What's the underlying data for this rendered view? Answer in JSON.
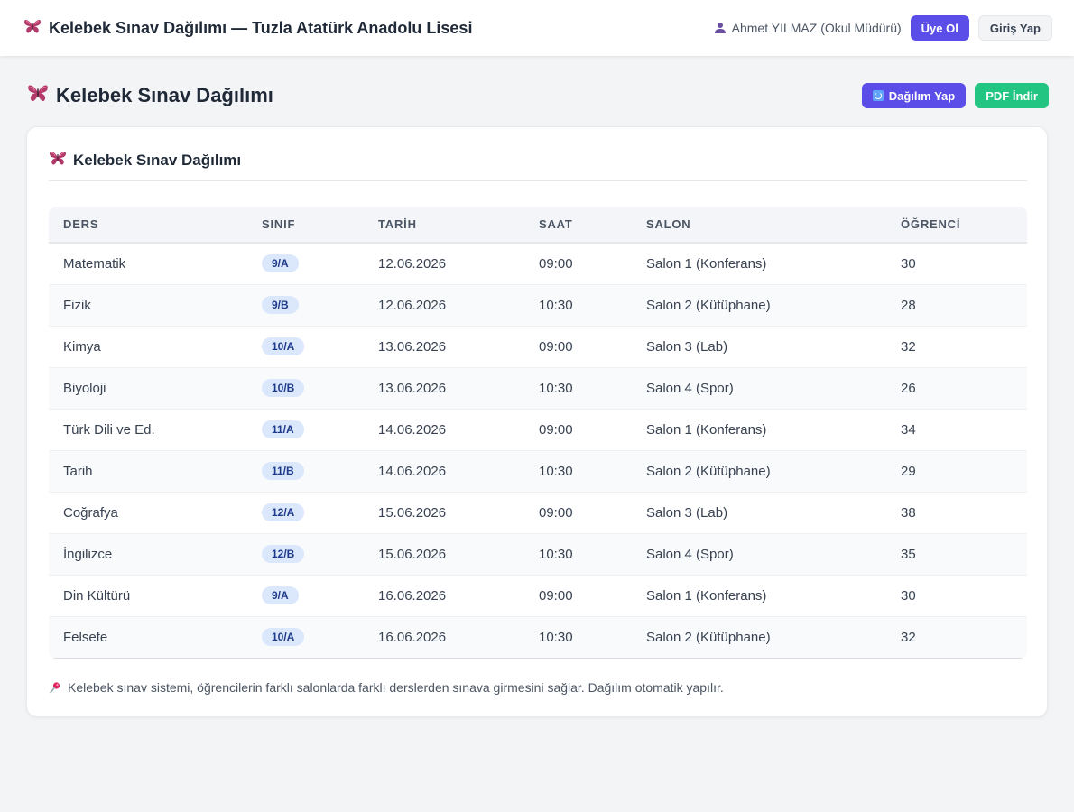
{
  "header": {
    "title": "Kelebek Sınav Dağılımı — Tuzla Atatürk Anadolu Lisesi",
    "user_name": "Ahmet YILMAZ (Okul Müdürü)",
    "signup_label": "Üye Ol",
    "login_label": "Giriş Yap"
  },
  "page": {
    "title": "Kelebek Sınav Dağılımı",
    "distribute_label": "Dağılım Yap",
    "pdf_label": "PDF İndir"
  },
  "card": {
    "title": "Kelebek Sınav Dağılımı",
    "columns": [
      "DERS",
      "SINIF",
      "TARİH",
      "SAAT",
      "SALON",
      "ÖĞRENCİ"
    ],
    "rows": [
      {
        "ders": "Matematik",
        "sinif": "9/A",
        "tarih": "12.06.2026",
        "saat": "09:00",
        "salon": "Salon 1 (Konferans)",
        "ogrenci": "30"
      },
      {
        "ders": "Fizik",
        "sinif": "9/B",
        "tarih": "12.06.2026",
        "saat": "10:30",
        "salon": "Salon 2 (Kütüphane)",
        "ogrenci": "28"
      },
      {
        "ders": "Kimya",
        "sinif": "10/A",
        "tarih": "13.06.2026",
        "saat": "09:00",
        "salon": "Salon 3 (Lab)",
        "ogrenci": "32"
      },
      {
        "ders": "Biyoloji",
        "sinif": "10/B",
        "tarih": "13.06.2026",
        "saat": "10:30",
        "salon": "Salon 4 (Spor)",
        "ogrenci": "26"
      },
      {
        "ders": "Türk Dili ve Ed.",
        "sinif": "11/A",
        "tarih": "14.06.2026",
        "saat": "09:00",
        "salon": "Salon 1 (Konferans)",
        "ogrenci": "34"
      },
      {
        "ders": "Tarih",
        "sinif": "11/B",
        "tarih": "14.06.2026",
        "saat": "10:30",
        "salon": "Salon 2 (Kütüphane)",
        "ogrenci": "29"
      },
      {
        "ders": "Coğrafya",
        "sinif": "12/A",
        "tarih": "15.06.2026",
        "saat": "09:00",
        "salon": "Salon 3 (Lab)",
        "ogrenci": "38"
      },
      {
        "ders": "İngilizce",
        "sinif": "12/B",
        "tarih": "15.06.2026",
        "saat": "10:30",
        "salon": "Salon 4 (Spor)",
        "ogrenci": "35"
      },
      {
        "ders": "Din Kültürü",
        "sinif": "9/A",
        "tarih": "16.06.2026",
        "saat": "09:00",
        "salon": "Salon 1 (Konferans)",
        "ogrenci": "30"
      },
      {
        "ders": "Felsefe",
        "sinif": "10/A",
        "tarih": "16.06.2026",
        "saat": "10:30",
        "salon": "Salon 2 (Kütüphane)",
        "ogrenci": "32"
      }
    ],
    "note": "Kelebek sınav sistemi, öğrencilerin farklı salonlarda farklı derslerden sınava girmesini sağlar. Dağılım otomatik yapılır."
  },
  "icons": {
    "brand": "butterfly-icon",
    "user": "user-icon",
    "distribute": "refresh-icon",
    "note": "pushpin-icon"
  },
  "colors": {
    "primary": "#5b4ee8",
    "success": "#22c581",
    "badge_bg": "#dbe7fb",
    "badge_text": "#1e3a8a"
  }
}
